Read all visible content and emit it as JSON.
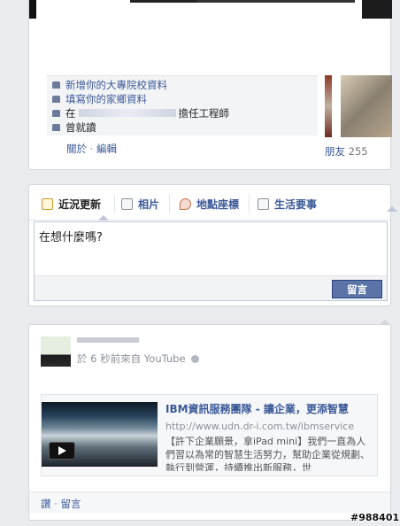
{
  "about": {
    "items": [
      {
        "icon": "graduation-cap-icon",
        "text": "新增你的大專院校資料"
      },
      {
        "icon": "home-icon",
        "text": "填寫你的家鄉資料"
      },
      {
        "icon": "briefcase-icon",
        "prefix": "在",
        "suffix": "擔任工程師"
      },
      {
        "icon": "graduation-cap-icon",
        "text": "曾就讀"
      }
    ],
    "about_link": "關於",
    "separator": "·",
    "edit_link": "編輯",
    "friends_label": "朋友",
    "friends_count": "255"
  },
  "composer": {
    "tabs": [
      {
        "label": "近況更新",
        "icon": "status-icon"
      },
      {
        "label": "相片",
        "icon": "photo-icon"
      },
      {
        "label": "地點座標",
        "icon": "location-pin-icon"
      },
      {
        "label": "生活要事",
        "icon": "life-event-icon"
      }
    ],
    "placeholder": "在想什麼嗎?",
    "post_button": "留言"
  },
  "story": {
    "meta_time": "於 6 秒前來自",
    "meta_source": "YouTube",
    "attachment": {
      "title": "IBM資訊服務團隊 - 讓企業，更添智慧",
      "url": "http://www.udn.dr-i.com.tw/ibmservice",
      "description": "【許下企業願景，拿iPad mini】我們一直為人們習以為常的智慧生活努力，幫助企業從規劃、執行到營運，持續推出新服務，世"
    },
    "actions": {
      "like": "讚",
      "sep": "·",
      "comment": "留言"
    }
  },
  "watermark": "#988401"
}
